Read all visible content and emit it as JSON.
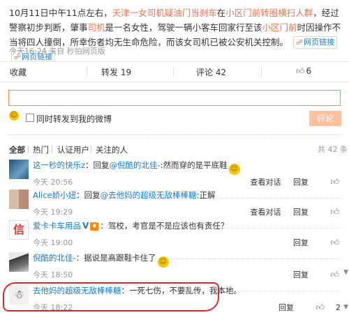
{
  "post": {
    "seg1": "10月11日中午11点左右，",
    "link1": "天津一女司机疑油门当刹车",
    "seg2": "在",
    "link2": "小区门前转圈横扫人群",
    "seg3": "，经过警察初步判断，肇事",
    "link3": "司机",
    "seg4": "是一名女性，驾驶一辆小客车回家行至该",
    "link4": "小区门前",
    "seg5": "时因操作不当将四人撞倒，所幸伤者均无生命危险，而该女司机已被公安机关控制。",
    "tag1": "网页链接",
    "tag2": "网页链接",
    "meta": "今天16:24 来自 秒拍网页版"
  },
  "actions": {
    "favorite": "收藏",
    "repost": "转发 19",
    "comment": "评论 42",
    "like": "6"
  },
  "compose": {
    "checkbox_label": "同时转发到我的微博",
    "submit": "评论"
  },
  "filters": {
    "all": "全部",
    "hot": "热门",
    "verified": "认证用户",
    "following": "关注的人",
    "count": "共 42 条"
  },
  "comments": [
    {
      "user": "这一秒的快乐z",
      "text_pre": "：回复",
      "mention": "@倪酷的北佳-",
      "text": ":然而穿的是平底鞋",
      "emoji": true,
      "time": "今天 20:56",
      "actions": [
        "查看对话",
        "回复"
      ],
      "likes": "",
      "avatar_color": "#3a6a8a"
    },
    {
      "user": "Alice娇小妞",
      "text_pre": "：回复",
      "mention": "@去他妈的超级无敌棒棒糖",
      "text": ":正解",
      "emoji": false,
      "time": "今天 19:29",
      "actions": [
        "查看对话",
        "回复"
      ],
      "likes": "",
      "avatar_color": "#c7a996"
    },
    {
      "user": "爱卡卡车用品",
      "text_pre": "",
      "mention": "",
      "text": "：驾校，考官是不是应该也有责任？",
      "emoji": false,
      "time": "今天 19:00",
      "actions": [
        "回复"
      ],
      "likes": "",
      "avatar_color": "#d33a2c",
      "avatar_text": "信"
    },
    {
      "user": "倪酷的北佳-",
      "text_pre": "",
      "mention": "",
      "text": "：据说是高跟鞋卡住了",
      "emoji": true,
      "time": "今天 18:50",
      "actions": [
        "回复"
      ],
      "likes": "",
      "avatar_color": "#555555"
    },
    {
      "user": "去他妈的超级无敌棒棒糖",
      "text_pre": "",
      "mention": "",
      "text": "：一死七伤，不要乱传，我本地。",
      "emoji": false,
      "time": "今天 18:22",
      "actions": [
        "回复"
      ],
      "likes": "2",
      "avatar_color": "#e8e8e8"
    }
  ],
  "colors": {
    "accent": "#eb7350",
    "link_blue": "#1a7ec8",
    "highlight_circle": "#e0242c"
  }
}
